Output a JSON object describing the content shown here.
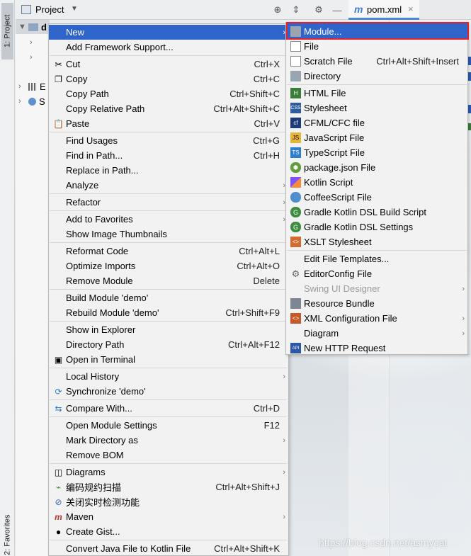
{
  "sidebar": {
    "project_tab": "1: Project",
    "favorites_tab": "2: Favorites"
  },
  "header": {
    "panel_title": "Project",
    "dropdown_icon": "chevron-down-icon",
    "icons": [
      "locate-icon",
      "collapse-icon",
      "gear-icon",
      "hide-icon"
    ],
    "file_tab": "pom.xml",
    "file_tab_icon": "m",
    "file_tab_close": "×"
  },
  "tree": {
    "root": "d",
    "items": [
      "",
      "",
      "",
      "E",
      "S"
    ]
  },
  "context_menu": [
    {
      "label": "New",
      "shortcut": "",
      "submenu": true,
      "highlighted": true,
      "icon": ""
    },
    {
      "label": "Add Framework Support...",
      "shortcut": "",
      "icon": ""
    },
    {
      "sep": true
    },
    {
      "label": "Cut",
      "shortcut": "Ctrl+X",
      "icon": "scissors-icon"
    },
    {
      "label": "Copy",
      "shortcut": "Ctrl+C",
      "icon": "copy-icon"
    },
    {
      "label": "Copy Path",
      "shortcut": "Ctrl+Shift+C",
      "icon": ""
    },
    {
      "label": "Copy Relative Path",
      "shortcut": "Ctrl+Alt+Shift+C",
      "icon": ""
    },
    {
      "label": "Paste",
      "shortcut": "Ctrl+V",
      "icon": "clipboard-icon"
    },
    {
      "sep": true
    },
    {
      "label": "Find Usages",
      "shortcut": "Ctrl+G",
      "icon": ""
    },
    {
      "label": "Find in Path...",
      "shortcut": "Ctrl+H",
      "icon": ""
    },
    {
      "label": "Replace in Path...",
      "shortcut": "",
      "icon": ""
    },
    {
      "label": "Analyze",
      "shortcut": "",
      "submenu": true,
      "icon": ""
    },
    {
      "sep": true
    },
    {
      "label": "Refactor",
      "shortcut": "",
      "submenu": true,
      "icon": ""
    },
    {
      "sep": true
    },
    {
      "label": "Add to Favorites",
      "shortcut": "",
      "submenu": true,
      "icon": ""
    },
    {
      "label": "Show Image Thumbnails",
      "shortcut": "",
      "icon": ""
    },
    {
      "sep": true
    },
    {
      "label": "Reformat Code",
      "shortcut": "Ctrl+Alt+L",
      "icon": ""
    },
    {
      "label": "Optimize Imports",
      "shortcut": "Ctrl+Alt+O",
      "icon": ""
    },
    {
      "label": "Remove Module",
      "shortcut": "Delete",
      "icon": ""
    },
    {
      "sep": true
    },
    {
      "label": "Build Module 'demo'",
      "shortcut": "",
      "icon": ""
    },
    {
      "label": "Rebuild Module 'demo'",
      "shortcut": "Ctrl+Shift+F9",
      "icon": ""
    },
    {
      "sep": true
    },
    {
      "label": "Show in Explorer",
      "shortcut": "",
      "icon": ""
    },
    {
      "label": "Directory Path",
      "shortcut": "Ctrl+Alt+F12",
      "icon": ""
    },
    {
      "label": "Open in Terminal",
      "shortcut": "",
      "icon": "terminal-icon"
    },
    {
      "sep": true
    },
    {
      "label": "Local History",
      "shortcut": "",
      "submenu": true,
      "icon": ""
    },
    {
      "label": "Synchronize 'demo'",
      "shortcut": "",
      "icon": "sync-icon"
    },
    {
      "sep": true
    },
    {
      "label": "Compare With...",
      "shortcut": "Ctrl+D",
      "icon": "compare-icon"
    },
    {
      "sep": true
    },
    {
      "label": "Open Module Settings",
      "shortcut": "F12",
      "icon": ""
    },
    {
      "label": "Mark Directory as",
      "shortcut": "",
      "submenu": true,
      "icon": ""
    },
    {
      "label": "Remove BOM",
      "shortcut": "",
      "icon": ""
    },
    {
      "sep": true
    },
    {
      "label": "Diagrams",
      "shortcut": "",
      "submenu": true,
      "icon": "diagram-icon"
    },
    {
      "label": "编码规约扫描",
      "shortcut": "Ctrl+Alt+Shift+J",
      "icon": "scan-icon"
    },
    {
      "label": "关闭实时检测功能",
      "shortcut": "",
      "icon": "no-entry-icon"
    },
    {
      "label": "Maven",
      "shortcut": "",
      "submenu": true,
      "icon": "maven-icon"
    },
    {
      "label": "Create Gist...",
      "shortcut": "",
      "icon": "github-icon"
    },
    {
      "sep": true
    },
    {
      "label": "Convert Java File to Kotlin File",
      "shortcut": "Ctrl+Alt+Shift+K",
      "icon": ""
    }
  ],
  "submenu": [
    {
      "label": "Module...",
      "shortcut": "",
      "icon": "module-folder-icon",
      "cls": "fold",
      "highlighted": true
    },
    {
      "label": "File",
      "shortcut": "",
      "icon": "file-icon",
      "cls": "file"
    },
    {
      "label": "Scratch File",
      "shortcut": "Ctrl+Alt+Shift+Insert",
      "icon": "scratch-file-icon",
      "cls": "file"
    },
    {
      "label": "Directory",
      "shortcut": "",
      "icon": "folder-icon",
      "cls": "fold"
    },
    {
      "sep": true
    },
    {
      "label": "HTML File",
      "shortcut": "",
      "icon": "html-icon",
      "cls": "html",
      "glyph": "H"
    },
    {
      "label": "Stylesheet",
      "shortcut": "",
      "icon": "css-icon",
      "cls": "css",
      "glyph": "CSS"
    },
    {
      "label": "CFML/CFC file",
      "shortcut": "",
      "icon": "cfml-icon",
      "cls": "cf",
      "glyph": "cf"
    },
    {
      "label": "JavaScript File",
      "shortcut": "",
      "icon": "javascript-icon",
      "cls": "js",
      "glyph": "JS"
    },
    {
      "label": "TypeScript File",
      "shortcut": "",
      "icon": "typescript-icon",
      "cls": "ts",
      "glyph": "TS"
    },
    {
      "label": "package.json File",
      "shortcut": "",
      "icon": "nodejs-icon",
      "cls": "pkg",
      "glyph": "⬢"
    },
    {
      "label": "Kotlin Script",
      "shortcut": "",
      "icon": "kotlin-icon",
      "cls": "kt"
    },
    {
      "label": "CoffeeScript File",
      "shortcut": "",
      "icon": "coffeescript-icon",
      "cls": "coffee"
    },
    {
      "label": "Gradle Kotlin DSL Build Script",
      "shortcut": "",
      "icon": "gradle-icon",
      "cls": "gradle",
      "glyph": "G"
    },
    {
      "label": "Gradle Kotlin DSL Settings",
      "shortcut": "",
      "icon": "gradle-icon",
      "cls": "gradle",
      "glyph": "G"
    },
    {
      "label": "XSLT Stylesheet",
      "shortcut": "",
      "icon": "xslt-icon",
      "cls": "xslt",
      "glyph": "<>"
    },
    {
      "sep": true
    },
    {
      "label": "Edit File Templates...",
      "shortcut": "",
      "icon": "",
      "cls": ""
    },
    {
      "label": "EditorConfig File",
      "shortcut": "",
      "icon": "editorconfig-icon",
      "cls": "cfg",
      "glyph": "⚙"
    },
    {
      "label": "Swing UI Designer",
      "shortcut": "",
      "icon": "",
      "cls": "",
      "submenu": true,
      "disabled": true
    },
    {
      "label": "Resource Bundle",
      "shortcut": "",
      "icon": "resource-bundle-icon",
      "cls": "rb"
    },
    {
      "label": "XML Configuration File",
      "shortcut": "",
      "icon": "xml-icon",
      "cls": "xml",
      "glyph": "<>",
      "submenu": true
    },
    {
      "label": "Diagram",
      "shortcut": "",
      "icon": "",
      "cls": "",
      "submenu": true
    },
    {
      "label": "New HTTP Request",
      "shortcut": "",
      "icon": "api-icon",
      "cls": "api",
      "glyph": "API"
    }
  ],
  "watermark": "https://blog.csdn.net/asmycat",
  "colors": {
    "highlight": "#2f65ca",
    "module_outline": "#e8202a"
  }
}
